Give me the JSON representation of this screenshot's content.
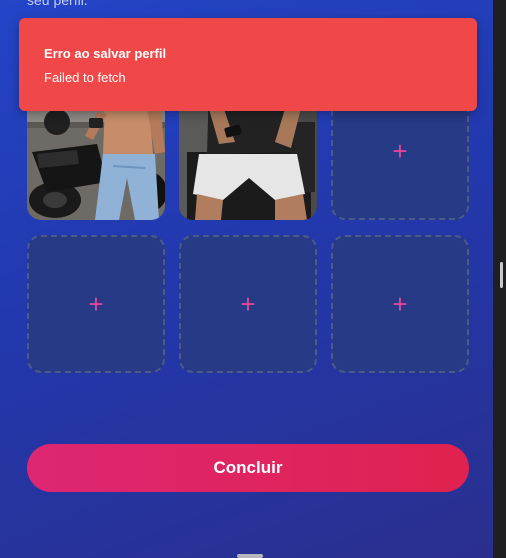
{
  "page": {
    "subtitle": "seu perfil."
  },
  "photos": [
    {
      "type": "photo",
      "icon": "photo-man-motorcycle",
      "plus": ""
    },
    {
      "type": "photo",
      "icon": "photo-man-chair",
      "plus": ""
    },
    {
      "type": "empty",
      "icon": "plus-icon",
      "plus": "+"
    },
    {
      "type": "empty",
      "icon": "plus-icon",
      "plus": "+"
    },
    {
      "type": "empty",
      "icon": "plus-icon",
      "plus": "+"
    },
    {
      "type": "empty",
      "icon": "plus-icon",
      "plus": "+"
    }
  ],
  "actions": {
    "conclude_label": "Concluir"
  },
  "toast": {
    "title": "Erro ao salvar perfil",
    "description": "Failed to fetch"
  },
  "colors": {
    "background_start": "#2345c7",
    "background_end": "#2a2f8e",
    "toast_bg": "#f04848",
    "button_start": "#de2673",
    "button_end": "#e0224f",
    "plus": "#e0459a"
  }
}
